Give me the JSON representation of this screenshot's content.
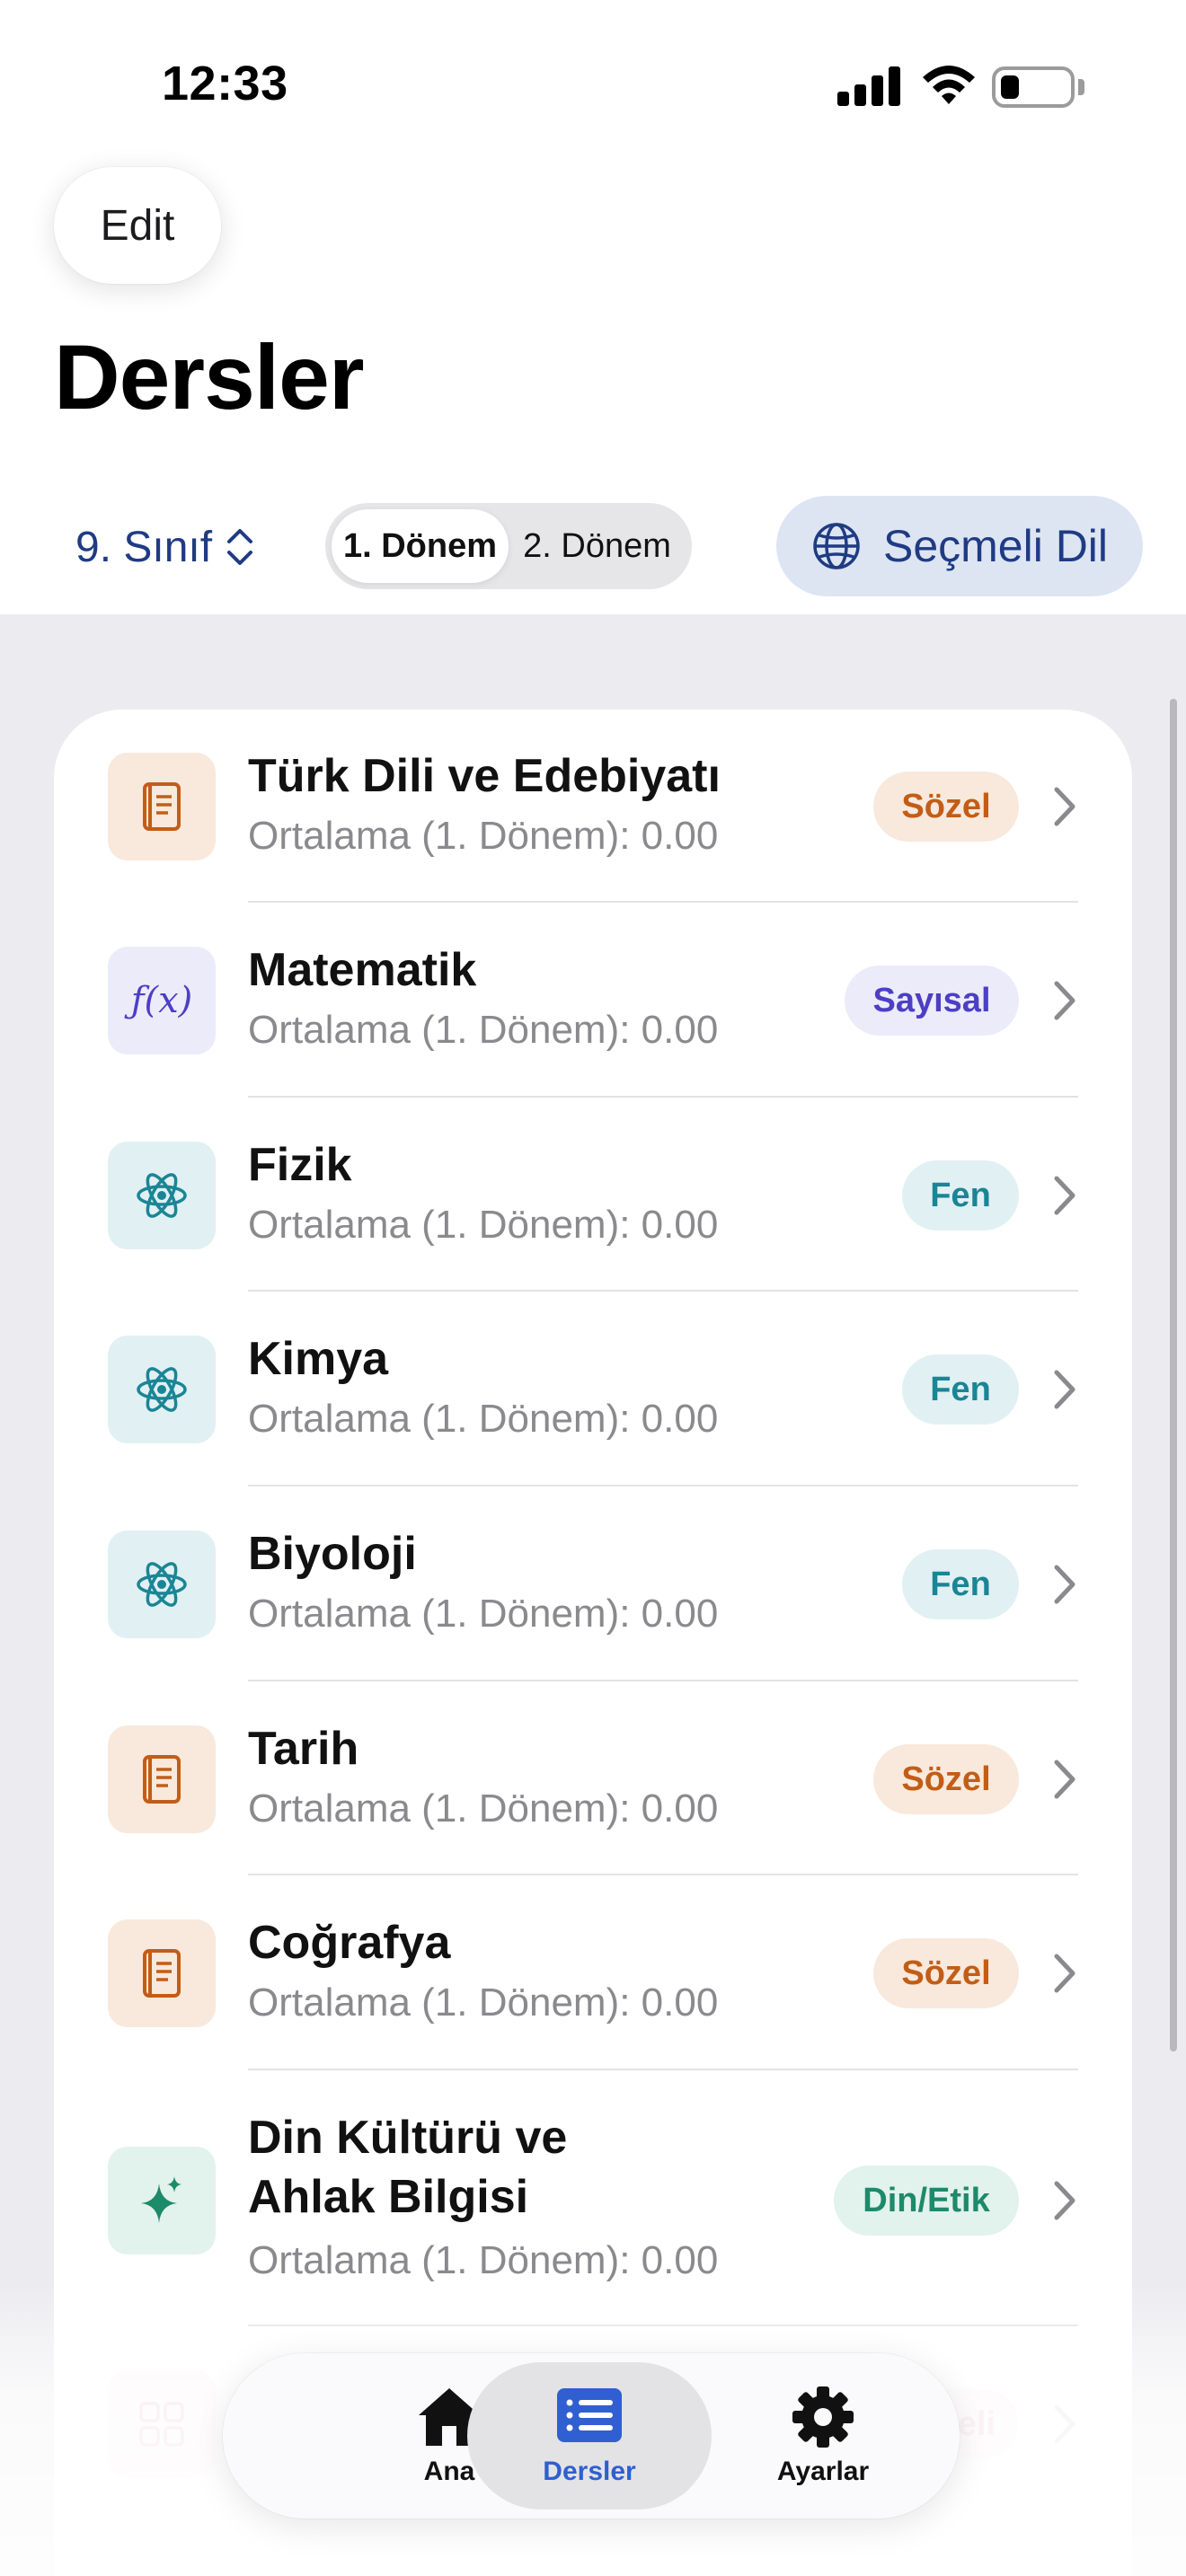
{
  "status_bar": {
    "time": "12:33"
  },
  "header": {
    "edit_label": "Edit",
    "title": "Dersler"
  },
  "toolbar": {
    "grade": "9. Sınıf",
    "terms": [
      "1. Dönem",
      "2. Dönem"
    ],
    "active_term": "1. Dönem",
    "language_label": "Seçmeli Dil"
  },
  "courses": [
    {
      "title": "Türk Dili ve Edebiyatı",
      "subtitle": "Ortalama (1. Dönem): 0.00",
      "badge": "Sözel",
      "icon": "book-icon"
    },
    {
      "title": "Matematik",
      "subtitle": "Ortalama (1. Dönem): 0.00",
      "badge": "Sayısal",
      "icon": "function-icon",
      "icon_text": "ƒ(x)"
    },
    {
      "title": "Fizik",
      "subtitle": "Ortalama (1. Dönem): 0.00",
      "badge": "Fen",
      "icon": "atom-icon"
    },
    {
      "title": "Kimya",
      "subtitle": "Ortalama (1. Dönem): 0.00",
      "badge": "Fen",
      "icon": "atom-icon"
    },
    {
      "title": "Biyoloji",
      "subtitle": "Ortalama (1. Dönem): 0.00",
      "badge": "Fen",
      "icon": "atom-icon"
    },
    {
      "title": "Tarih",
      "subtitle": "Ortalama (1. Dönem): 0.00",
      "badge": "Sözel",
      "icon": "book-icon"
    },
    {
      "title": "Coğrafya",
      "subtitle": "Ortalama (1. Dönem): 0.00",
      "badge": "Sözel",
      "icon": "book-icon"
    },
    {
      "title_line1": "Din Kültürü ve",
      "title_line2": "Ahlak Bilgisi",
      "subtitle": "Ortalama (1. Dönem): 0.00",
      "badge": "Din/Etik",
      "icon": "sparkle-icon"
    },
    {
      "badge_partial": "eli",
      "icon": "grid-icon"
    }
  ],
  "tabbar": {
    "tabs": [
      {
        "label": "Ana",
        "icon": "house-icon"
      },
      {
        "label": "Dersler",
        "icon": "list-icon"
      },
      {
        "label": "Ayarlar",
        "icon": "gear-icon"
      }
    ],
    "active_tab": "Dersler"
  },
  "colors": {
    "accent": "#1f3b83",
    "sozel": "#c25d17",
    "sayisal": "#4c3fc4",
    "fen": "#1a8595",
    "din": "#1d8a6a",
    "tab_active": "#2f5fd0"
  }
}
